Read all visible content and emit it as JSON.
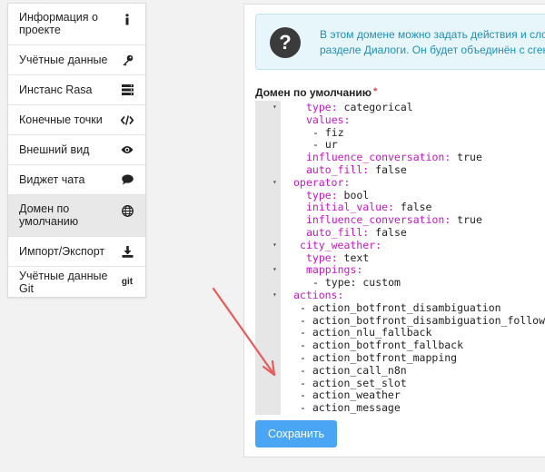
{
  "sidebar": {
    "items": [
      {
        "label": "Информация о проекте",
        "icon": "info-icon"
      },
      {
        "label": "Учётные данные",
        "icon": "key-icon"
      },
      {
        "label": "Инстанс Rasa",
        "icon": "server-icon"
      },
      {
        "label": "Конечные точки",
        "icon": "code-icon"
      },
      {
        "label": "Внешний вид",
        "icon": "eye-icon"
      },
      {
        "label": "Виджет чата",
        "icon": "chat-bubble-icon"
      },
      {
        "label": "Домен по умолчанию",
        "icon": "globe-icon",
        "active": true
      },
      {
        "label": "Импорт/Экспорт",
        "icon": "download-icon"
      },
      {
        "label": "Учётные данные Git",
        "icon": "git-icon",
        "icon_text": "git"
      }
    ]
  },
  "info": {
    "icon": "question-circle-icon",
    "icon_char": "?",
    "line1": "В этом домене можно задать действия и слоты",
    "line2": "разделе Диалоги. Он будет объединён с сгене"
  },
  "field": {
    "label": "Домен по умолчанию",
    "required_mark": "*"
  },
  "code": {
    "lines": [
      {
        "k": "type:",
        "v": " categorical"
      },
      {
        "k": "values:",
        "v": ""
      },
      {
        "k": "",
        "v": "- fiz"
      },
      {
        "k": "",
        "v": "- ur"
      },
      {
        "k": "influence_conversation:",
        "v": " true"
      },
      {
        "k": "auto_fill:",
        "v": " false"
      },
      {
        "k": "operator:",
        "v": ""
      },
      {
        "k": "type:",
        "v": " bool"
      },
      {
        "k": "initial_value:",
        "v": " false"
      },
      {
        "k": "influence_conversation:",
        "v": " true"
      },
      {
        "k": "auto_fill:",
        "v": " false"
      },
      {
        "k": "city_weather:",
        "v": ""
      },
      {
        "k": "type:",
        "v": " text"
      },
      {
        "k": "mappings:",
        "v": ""
      },
      {
        "k": "",
        "v": "- type: custom"
      },
      {
        "k": "actions:",
        "v": ""
      },
      {
        "k": "",
        "v": "- action_botfront_disambiguation"
      },
      {
        "k": "",
        "v": "- action_botfront_disambiguation_followup"
      },
      {
        "k": "",
        "v": "- action_nlu_fallback"
      },
      {
        "k": "",
        "v": "- action_botfront_fallback"
      },
      {
        "k": "",
        "v": "- action_botfront_mapping"
      },
      {
        "k": "",
        "v": "- action_call_n8n"
      },
      {
        "k": "",
        "v": "- action_set_slot"
      },
      {
        "k": "",
        "v": "- action_weather"
      },
      {
        "k": "",
        "v": "- action_message"
      }
    ]
  },
  "save_button": {
    "label": "Сохранить"
  },
  "colors": {
    "key": "#c218c2",
    "button": "#4aa6f5",
    "info_text": "#1f8fb8",
    "arrow": "#e85b5b"
  }
}
